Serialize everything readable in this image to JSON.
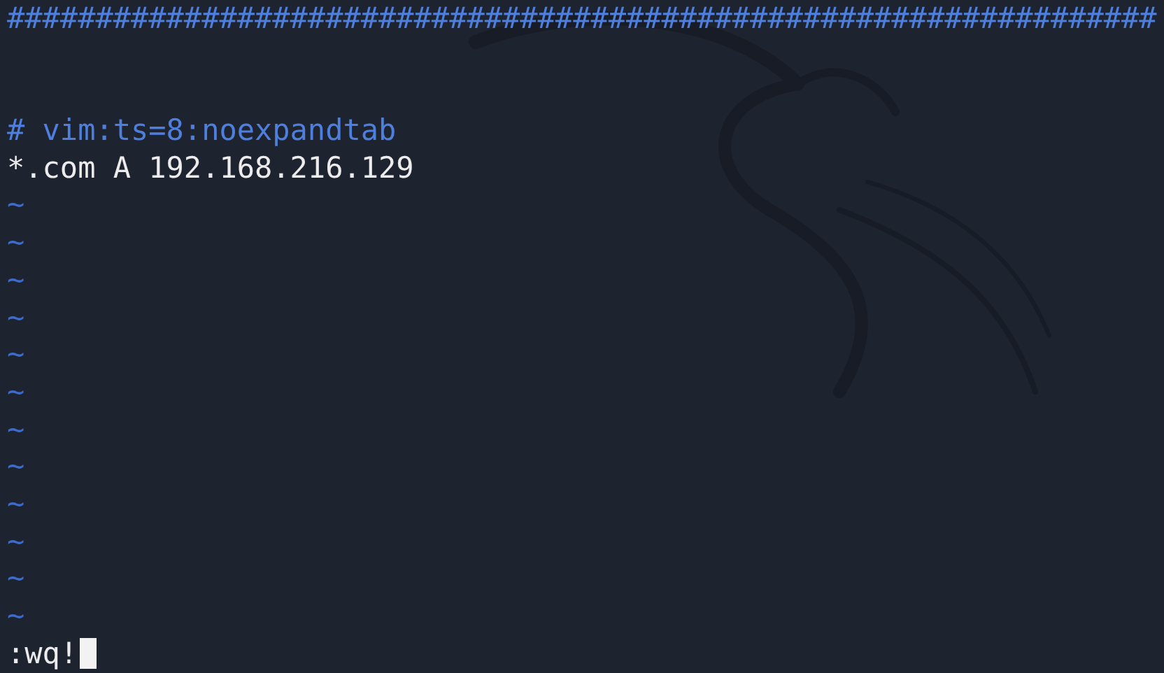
{
  "buffer_lines": [
    {
      "kind": "comment",
      "text": "#################################################################"
    },
    {
      "kind": "blank"
    },
    {
      "kind": "blank"
    },
    {
      "kind": "comment",
      "text": "# vim:ts=8:noexpandtab"
    },
    {
      "kind": "text",
      "text": "*.com A 192.168.216.129"
    },
    {
      "kind": "filler",
      "text": "~"
    },
    {
      "kind": "filler",
      "text": "~"
    },
    {
      "kind": "filler",
      "text": "~"
    },
    {
      "kind": "filler",
      "text": "~"
    },
    {
      "kind": "filler",
      "text": "~"
    },
    {
      "kind": "filler",
      "text": "~"
    },
    {
      "kind": "filler",
      "text": "~"
    },
    {
      "kind": "filler",
      "text": "~"
    },
    {
      "kind": "filler",
      "text": "~"
    },
    {
      "kind": "filler",
      "text": "~"
    },
    {
      "kind": "filler",
      "text": "~"
    },
    {
      "kind": "filler",
      "text": "~"
    }
  ],
  "command_line": {
    "text": ":wq!"
  }
}
